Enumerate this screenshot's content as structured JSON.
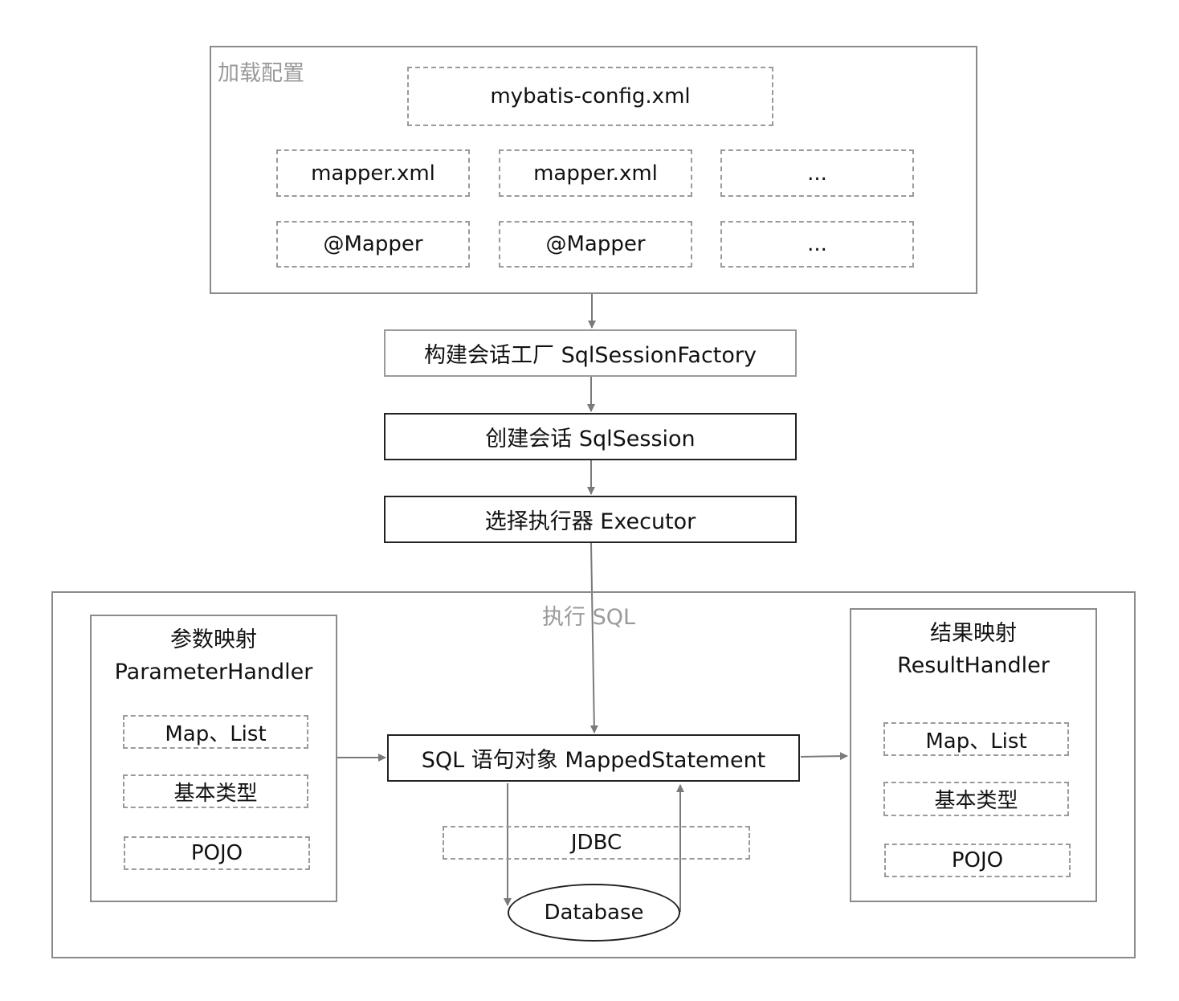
{
  "load_config": {
    "label": "加载配置",
    "config_file": "mybatis-config.xml",
    "row1": [
      "mapper.xml",
      "mapper.xml",
      "..."
    ],
    "row2": [
      "@Mapper",
      "@Mapper",
      "..."
    ]
  },
  "flow": {
    "factory": "构建会话工厂 SqlSessionFactory",
    "session": "创建会话 SqlSession",
    "executor": "选择执行器 Executor"
  },
  "execute": {
    "label": "执行 SQL",
    "mapped_statement": "SQL 语句对象 MappedStatement",
    "jdbc": "JDBC",
    "database": "Database",
    "parameter_panel": {
      "title_line1": "参数映射",
      "title_line2": "ParameterHandler",
      "items": [
        "Map、List",
        "基本类型",
        "POJO"
      ]
    },
    "result_panel": {
      "title_line1": "结果映射",
      "title_line2": "ResultHandler",
      "items": [
        "Map、List",
        "基本类型",
        "POJO"
      ]
    }
  }
}
